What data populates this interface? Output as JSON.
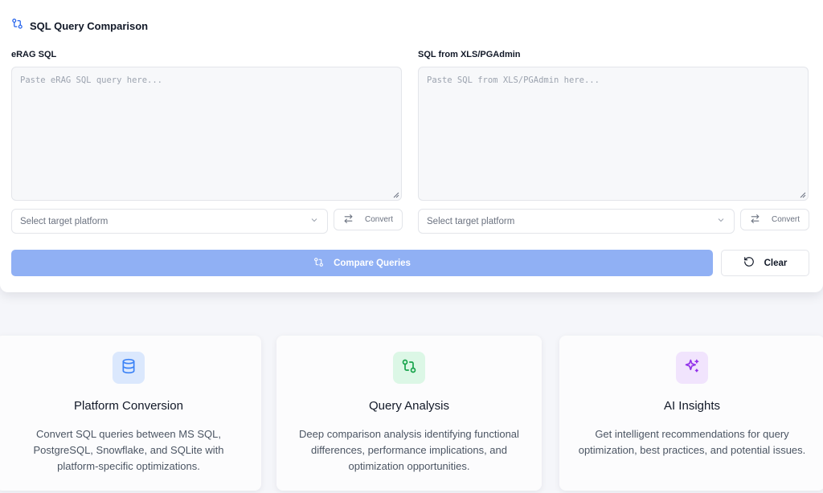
{
  "header": {
    "title": "SQL Query Comparison"
  },
  "left": {
    "label": "eRAG SQL",
    "placeholder": "Paste eRAG SQL query here...",
    "platform_placeholder": "Select target platform",
    "convert_label": "Convert"
  },
  "right": {
    "label": "SQL from XLS/PGAdmin",
    "placeholder": "Paste SQL from XLS/PGAdmin here...",
    "platform_placeholder": "Select target platform",
    "convert_label": "Convert"
  },
  "actions": {
    "compare_label": "Compare Queries",
    "clear_label": "Clear"
  },
  "features": [
    {
      "title": "Platform Conversion",
      "desc": "Convert SQL queries between MS SQL, PostgreSQL, Snowflake, and SQLite with platform-specific optimizations.",
      "icon": "database-icon",
      "color": "#3b82f6",
      "bg": "#dbe8fd"
    },
    {
      "title": "Query Analysis",
      "desc": "Deep comparison analysis identifying functional differences, performance implications, and optimization opportunities.",
      "icon": "git-compare-icon",
      "color": "#16a34a",
      "bg": "#dcf7e6"
    },
    {
      "title": "AI Insights",
      "desc": "Get intelligent recommendations for query optimization, best practices, and potential issues.",
      "icon": "sparkles-icon",
      "color": "#9333ea",
      "bg": "#f1e4fd"
    }
  ],
  "colors": {
    "accent": "#90b0f4",
    "title_icon": "#2563eb"
  }
}
